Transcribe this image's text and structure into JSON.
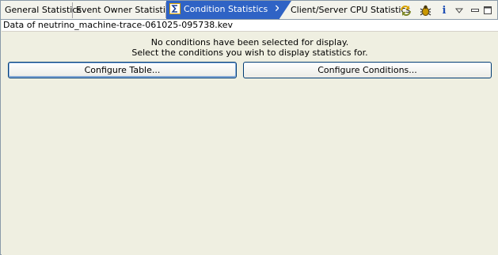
{
  "tabs": [
    {
      "label": "General Statistics",
      "active": false
    },
    {
      "label": "Event Owner Statistics",
      "active": false
    },
    {
      "label": "Condition Statistics",
      "active": true,
      "icon": "sigma-icon",
      "closable": true
    },
    {
      "label": "Client/Server CPU Statistics",
      "active": false
    }
  ],
  "toolbar": {
    "icons": [
      "refresh-icon",
      "bug-icon",
      "info-icon",
      "view-menu-icon",
      "minimize-icon",
      "maximize-icon"
    ],
    "info_glyph": "i"
  },
  "file": {
    "label": "Data of neutrino_machine-trace-061025-095738.kev"
  },
  "message": {
    "line1": "No conditions have been selected for display.",
    "line2": "Select the conditions you wish to display statistics for."
  },
  "buttons": {
    "configure_table": "Configure Table...",
    "configure_conditions": "Configure Conditions..."
  },
  "colors": {
    "active_tab": "#2f63c5",
    "background": "#efefe1",
    "button_border": "#003c74"
  }
}
